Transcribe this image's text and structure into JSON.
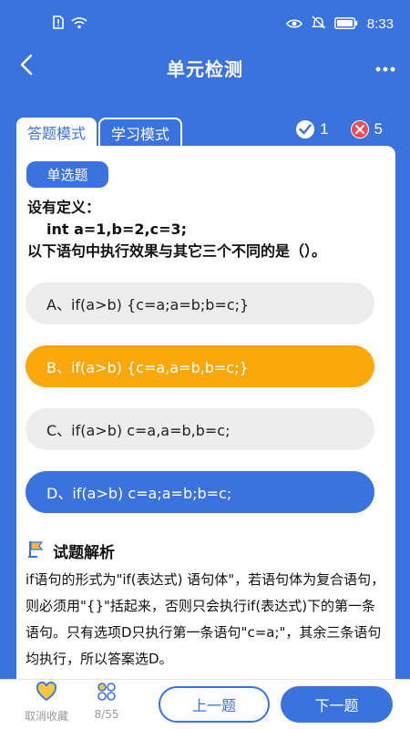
{
  "status_bar": {
    "time": "8:33"
  },
  "header": {
    "title": "单元检测"
  },
  "tabs": [
    {
      "label": "答题模式"
    },
    {
      "label": "学习模式"
    }
  ],
  "score": {
    "correct": "1",
    "wrong": "5"
  },
  "question": {
    "type": "单选题",
    "line1": "设有定义：",
    "line2": "int  a=1,b=2,c=3;",
    "line3": "以下语句中执行效果与其它三个不同的是（）。"
  },
  "options": [
    {
      "label": "A、if(a>b) {c=a;a=b;b=c;}",
      "state": "normal"
    },
    {
      "label": "B、if(a>b) {c=a,a=b,b=c;}",
      "state": "wrong"
    },
    {
      "label": "C、if(a>b) c=a,a=b,b=c;",
      "state": "normal"
    },
    {
      "label": "D、if(a>b) c=a;a=b;b=c;",
      "state": "correct"
    }
  ],
  "analysis": {
    "title": "试题解析",
    "text": "if语句的形式为\"if(表达式) 语句体\"，若语句体为复合语句，则必须用\"{}\"括起来，否则只会执行if(表达式)下的第一条语句。只有选项D只执行第一条语句\"c=a;\"，其余三条语句均执行，所以答案选D。"
  },
  "bottom": {
    "favorite_label": "取消收藏",
    "progress_label": "8/55",
    "prev_label": "上一题",
    "next_label": "下一题"
  },
  "colors": {
    "primary": "#3a73dd",
    "wrong": "#fca80d",
    "option_bg": "#ededed"
  }
}
